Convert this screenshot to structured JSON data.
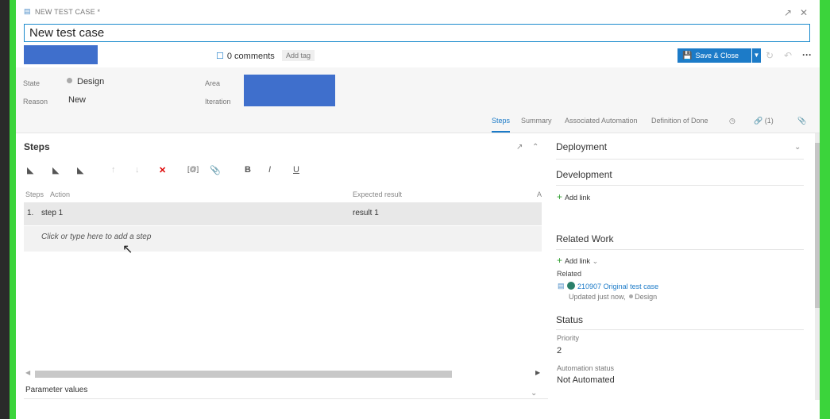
{
  "window": {
    "title": "NEW TEST CASE *",
    "title_input": "New test case"
  },
  "toolbar": {
    "comments": "0 comments",
    "add_tag": "Add tag",
    "save_close": "Save & Close",
    "more": "···"
  },
  "header": {
    "state_label": "State",
    "state_value": "Design",
    "reason_label": "Reason",
    "reason_value": "New",
    "area_label": "Area",
    "iteration_label": "Iteration"
  },
  "tabs": [
    {
      "label": "Steps"
    },
    {
      "label": "Summary"
    },
    {
      "label": "Associated Automation"
    },
    {
      "label": "Definition of Done"
    },
    {
      "label": "(1)"
    }
  ],
  "steps": {
    "title": "Steps",
    "col_steps": "Steps",
    "col_action": "Action",
    "col_expected": "Expected result",
    "col_a": "A",
    "rows": [
      {
        "num": "1.",
        "action": "step 1",
        "expected": "result 1"
      }
    ],
    "add_step_placeholder": "Click or type here to add a step",
    "parameter_values": "Parameter values"
  },
  "right": {
    "deployment": "Deployment",
    "development": "Development",
    "add_link": "Add link",
    "related_work": "Related Work",
    "add_link_dd": "Add link",
    "related": "Related",
    "related_item_id": "210907",
    "related_item_title": "Original test case",
    "related_item_meta": "Updated just now,",
    "related_item_state": "Design",
    "status": "Status",
    "priority_label": "Priority",
    "priority_value": "2",
    "automation_label": "Automation status",
    "automation_value": "Not Automated"
  },
  "colors": {
    "accent": "#1c7bc8",
    "redacted": "#3f6fcc",
    "frame_green": "#3bd43b"
  }
}
